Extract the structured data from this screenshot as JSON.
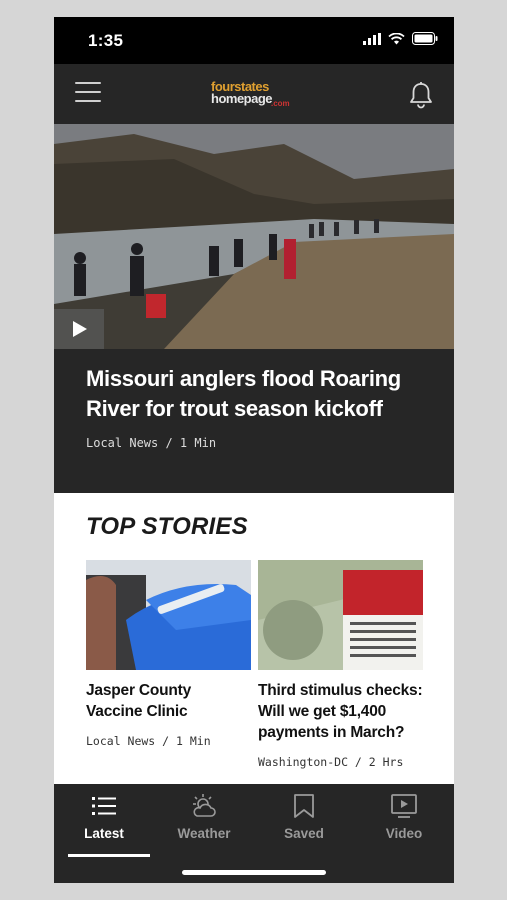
{
  "status_bar": {
    "time": "1:35",
    "icons": [
      "cellular-signal-icon",
      "wifi-icon",
      "battery-icon"
    ]
  },
  "header": {
    "logo_line1": "fourstates",
    "logo_line2": "homepage",
    "logo_suffix": ".com",
    "menu_icon": "hamburger-menu-icon",
    "notification_icon": "bell-icon"
  },
  "hero": {
    "title": "Missouri anglers flood Roaring River for trout season kickoff",
    "meta": "Local News / 1 Min",
    "play_icon": "play-icon"
  },
  "top_stories": {
    "heading": "TOP STORIES",
    "items": [
      {
        "title": "Jasper County Vaccine Clinic",
        "meta": "Local News / 1 Min"
      },
      {
        "title": "Third stimulus checks: Will we get $1,400 payments in March?",
        "meta": "Washington-DC / 2 Hrs"
      }
    ]
  },
  "tabs": [
    {
      "label": "Latest",
      "icon": "list-icon",
      "active": true
    },
    {
      "label": "Weather",
      "icon": "weather-icon",
      "active": false
    },
    {
      "label": "Saved",
      "icon": "bookmark-icon",
      "active": false
    },
    {
      "label": "Video",
      "icon": "video-icon",
      "active": false
    }
  ],
  "colors": {
    "header_bg": "#262626",
    "accent_logo": "#e0a030",
    "tab_inactive": "#9a9a9a",
    "card_bg": "#ffffff"
  }
}
